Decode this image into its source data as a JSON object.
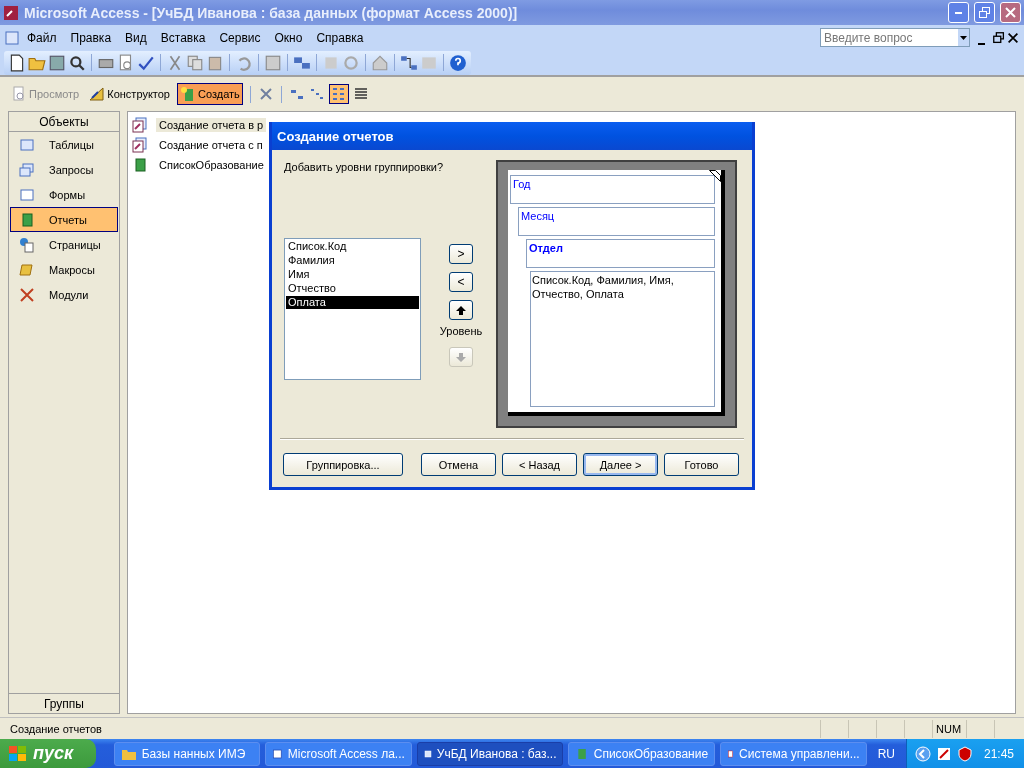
{
  "window": {
    "title": "Microsoft Access - [УчБД Иванова : база данных (формат Access 2000)]"
  },
  "menu": {
    "items": [
      {
        "label": "Файл"
      },
      {
        "label": "Правка"
      },
      {
        "label": "Вид"
      },
      {
        "label": "Вставка"
      },
      {
        "label": "Сервис"
      },
      {
        "label": "Окно"
      },
      {
        "label": "Справка"
      }
    ],
    "help_search": {
      "placeholder": "Введите вопрос"
    }
  },
  "db_window": {
    "toolbar": [
      {
        "label": "Просмотр",
        "kind": "preview",
        "disabled": true,
        "selected": false
      },
      {
        "label": "Конструктор",
        "kind": "design",
        "disabled": false,
        "selected": false
      },
      {
        "label": "Создать",
        "kind": "new",
        "disabled": false,
        "selected": true
      }
    ],
    "sidebar": {
      "header": "Объекты",
      "items": [
        {
          "label": "Таблицы",
          "kind": "tables",
          "selected": false
        },
        {
          "label": "Запросы",
          "kind": "queries",
          "selected": false
        },
        {
          "label": "Формы",
          "kind": "forms",
          "selected": false
        },
        {
          "label": "Отчеты",
          "kind": "reports",
          "selected": true
        },
        {
          "label": "Страницы",
          "kind": "pages",
          "selected": false
        },
        {
          "label": "Макросы",
          "kind": "macros",
          "selected": false
        },
        {
          "label": "Модули",
          "kind": "modules",
          "selected": false
        }
      ],
      "footer": "Группы"
    },
    "objects": [
      {
        "label": "Создание отчета в р",
        "kind": "wizard",
        "selected": true
      },
      {
        "label": "Создание отчета с п",
        "kind": "wizard",
        "selected": false
      },
      {
        "label": "СписокОбразование",
        "kind": "report",
        "selected": false
      }
    ]
  },
  "dialog": {
    "title": "Создание отчетов",
    "prompt": "Добавить уровни группировки?",
    "fields": [
      {
        "label": "Список.Код",
        "selected": false
      },
      {
        "label": "Фамилия",
        "selected": false
      },
      {
        "label": "Имя",
        "selected": false
      },
      {
        "label": "Отчество",
        "selected": false
      },
      {
        "label": "Оплата",
        "selected": true
      }
    ],
    "add_button": ">",
    "remove_button": "<",
    "level_label": "Уровень",
    "level_up": {
      "disabled": false
    },
    "level_down": {
      "disabled": true
    },
    "groups": [
      {
        "label": "Год",
        "current": false
      },
      {
        "label": "Месяц",
        "current": false
      },
      {
        "label": "Отдел",
        "current": true
      }
    ],
    "detail": "Список.Код, Фамилия, Имя, Отчество, Оплата",
    "buttons": [
      {
        "label": "Группировка...",
        "default": false
      },
      {
        "label": "Отмена",
        "default": false
      },
      {
        "label": "< Назад",
        "default": false
      },
      {
        "label": "Далее >",
        "default": true
      },
      {
        "label": "Готово",
        "default": false
      }
    ]
  },
  "status_bar": {
    "text": "Создание отчетов",
    "indicators": [
      "NUM"
    ]
  },
  "taskbar": {
    "start": "пуск",
    "tasks": [
      {
        "label": "Базы нанных ИМЭ",
        "kind": "folder",
        "selected": false
      },
      {
        "label": "Microsoft Access ла...",
        "kind": "word",
        "selected": false
      },
      {
        "label": "УчБД Иванова : баз...",
        "kind": "database",
        "selected": true
      },
      {
        "label": "СписокОбразование",
        "kind": "report",
        "selected": false
      },
      {
        "label": "Система управлени...",
        "kind": "pdf",
        "selected": false
      }
    ],
    "language": "RU",
    "clock": "21:45"
  }
}
